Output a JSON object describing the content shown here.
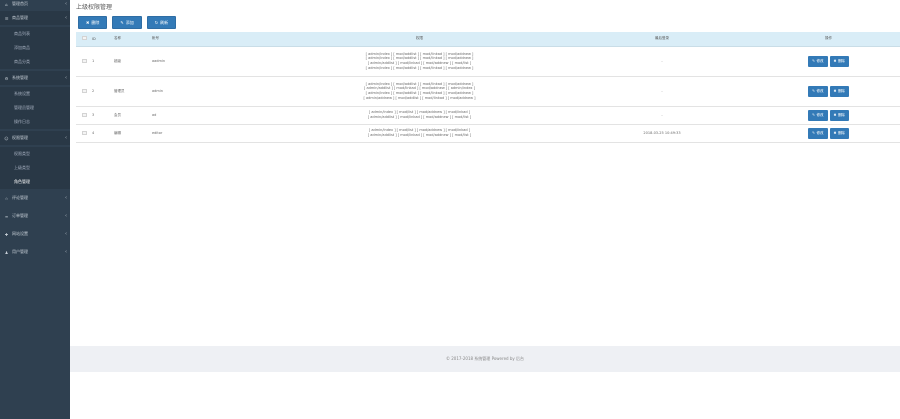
{
  "sidebar": {
    "items": [
      {
        "icon": "home-icon",
        "glyph": "⌂",
        "label": "管理首页",
        "chevron": "‹"
      },
      {
        "icon": "list-icon",
        "glyph": "☰",
        "label": "商品管理",
        "chevron": "‹",
        "children": [
          {
            "label": "商品列表"
          },
          {
            "label": "添加商品"
          },
          {
            "label": "商品分类"
          }
        ]
      },
      {
        "icon": "gear-icon",
        "glyph": "⚙",
        "label": "系统管理",
        "chevron": "‹",
        "children": [
          {
            "label": "系统设置"
          },
          {
            "label": "管理员管理"
          },
          {
            "label": "操作日志"
          }
        ]
      },
      {
        "icon": "user-icon",
        "glyph": "☺",
        "label": "权限管理",
        "chevron": "‹",
        "children": [
          {
            "label": "权限类型"
          },
          {
            "label": "上级类型"
          },
          {
            "label": "角色管理"
          }
        ]
      },
      {
        "icon": "star-icon",
        "glyph": "☆",
        "label": "评论管理",
        "chevron": "‹"
      },
      {
        "icon": "file-icon",
        "glyph": "≡",
        "label": "订单管理",
        "chevron": "‹"
      },
      {
        "icon": "wrench-icon",
        "glyph": "✚",
        "label": "网站设置",
        "chevron": "‹"
      },
      {
        "icon": "person-icon",
        "glyph": "♟",
        "label": "用户管理",
        "chevron": "‹"
      }
    ]
  },
  "header": {
    "title": "上级权限管理"
  },
  "toolbar": {
    "delete_label": "删除",
    "add_label": "添加",
    "refresh_label": "刷新"
  },
  "table": {
    "columns": [
      "",
      "ID",
      "名称",
      "帐号",
      "权限",
      "最后登录",
      "操作"
    ],
    "rows": [
      {
        "id": "1",
        "name": "超级",
        "account": "aadmin",
        "perms": [
          "[ admin/index ] [ mod/addlist ] [ mod/linkad ] [ mod/addnew ]",
          "[ admin/index ] [ mod/addlist ] [ mod/linkad ] [ mod/addnew ]",
          "[ admin/addlist ] [ mod/linkad ] [ mod/addnew ] [ mod/list ]",
          "[ admin/index ] [ mod/addlist ] [ mod/linkad ] [ mod/addnew ]"
        ],
        "login": "-",
        "edit": "修改",
        "del": "删除"
      },
      {
        "id": "2",
        "name": "管理员",
        "account": "admin",
        "perms": [
          "[ admin/index ] [ mod/addlist ] [ mod/linkad ] [ mod/addnew ]",
          "[ admin/addlist ] [ mod/linkad ] [ mod/addnew ] [ admin/index ]",
          "[ admin/index ] [ mod/addlist ] [ mod/linkad ] [ mod/addnew ]",
          "[ admin/addnew ] [ mod/addlist ] [ mod/linkad ] [ mod/addnew ]"
        ],
        "login": "-",
        "edit": "修改",
        "del": "删除"
      },
      {
        "id": "3",
        "name": "会员",
        "account": "ad",
        "perms": [
          "[ admin/index ] [ mod/list ] [ mod/addnew ] [ mod/linkad ]",
          "[ admin/addlist ] [ mod/linkad ] [ mod/addnew ] [ mod/list ]"
        ],
        "login": "-",
        "edit": "修改",
        "del": "删除"
      },
      {
        "id": "4",
        "name": "编辑",
        "account": "editor",
        "perms": [
          "[ admin/index ] [ mod/list ] [ mod/addnew ] [ mod/linkad ]",
          "[ admin/addlist ] [ mod/linkad ] [ mod/addnew ] [ mod/list ]"
        ],
        "login": "2018-03-25 10:49:33",
        "edit": "修改",
        "del": "删除"
      }
    ]
  },
  "footer": {
    "text": "© 2017-2018 系统管理 Powered by 后台"
  },
  "colors": {
    "sidebar": "#2f4050",
    "primary": "#337ab7",
    "table_header": "#d9edf7"
  }
}
